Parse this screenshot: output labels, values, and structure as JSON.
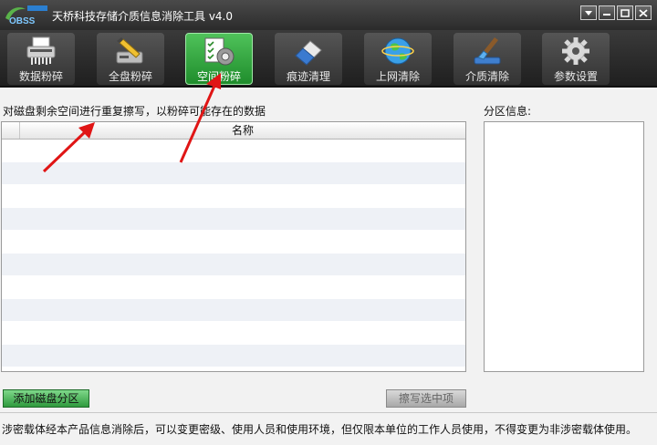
{
  "window": {
    "logo_text": "OBSS",
    "title": "天桥科技存储介质信息消除工具 v4.0"
  },
  "toolbar": [
    {
      "label": "数据粉碎",
      "icon": "shredder-icon",
      "active": false
    },
    {
      "label": "全盘粉碎",
      "icon": "disk-shred-icon",
      "active": false
    },
    {
      "label": "空间粉碎",
      "icon": "space-shred-icon",
      "active": true
    },
    {
      "label": "痕迹清理",
      "icon": "eraser-icon",
      "active": false
    },
    {
      "label": "上网清除",
      "icon": "globe-icon",
      "active": false
    },
    {
      "label": "介质清除",
      "icon": "brush-icon",
      "active": false
    },
    {
      "label": "参数设置",
      "icon": "gear-icon",
      "active": false
    }
  ],
  "main": {
    "description": "对磁盘剩余空间进行重复擦写，以粉碎可能存在的数据",
    "partition_label": "分区信息:",
    "table": {
      "columns": [
        "",
        "名称"
      ],
      "rows": []
    },
    "add_button": "添加磁盘分区",
    "wipe_button": "擦写选中项"
  },
  "footer": {
    "text": "涉密载体经本产品信息消除后，可以变更密级、使用人员和使用环境，但仅限本单位的工作人员使用，不得变更为非涉密载体使用。"
  },
  "colors": {
    "active_tab": "#2fa83c",
    "arrow": "#e01515"
  }
}
